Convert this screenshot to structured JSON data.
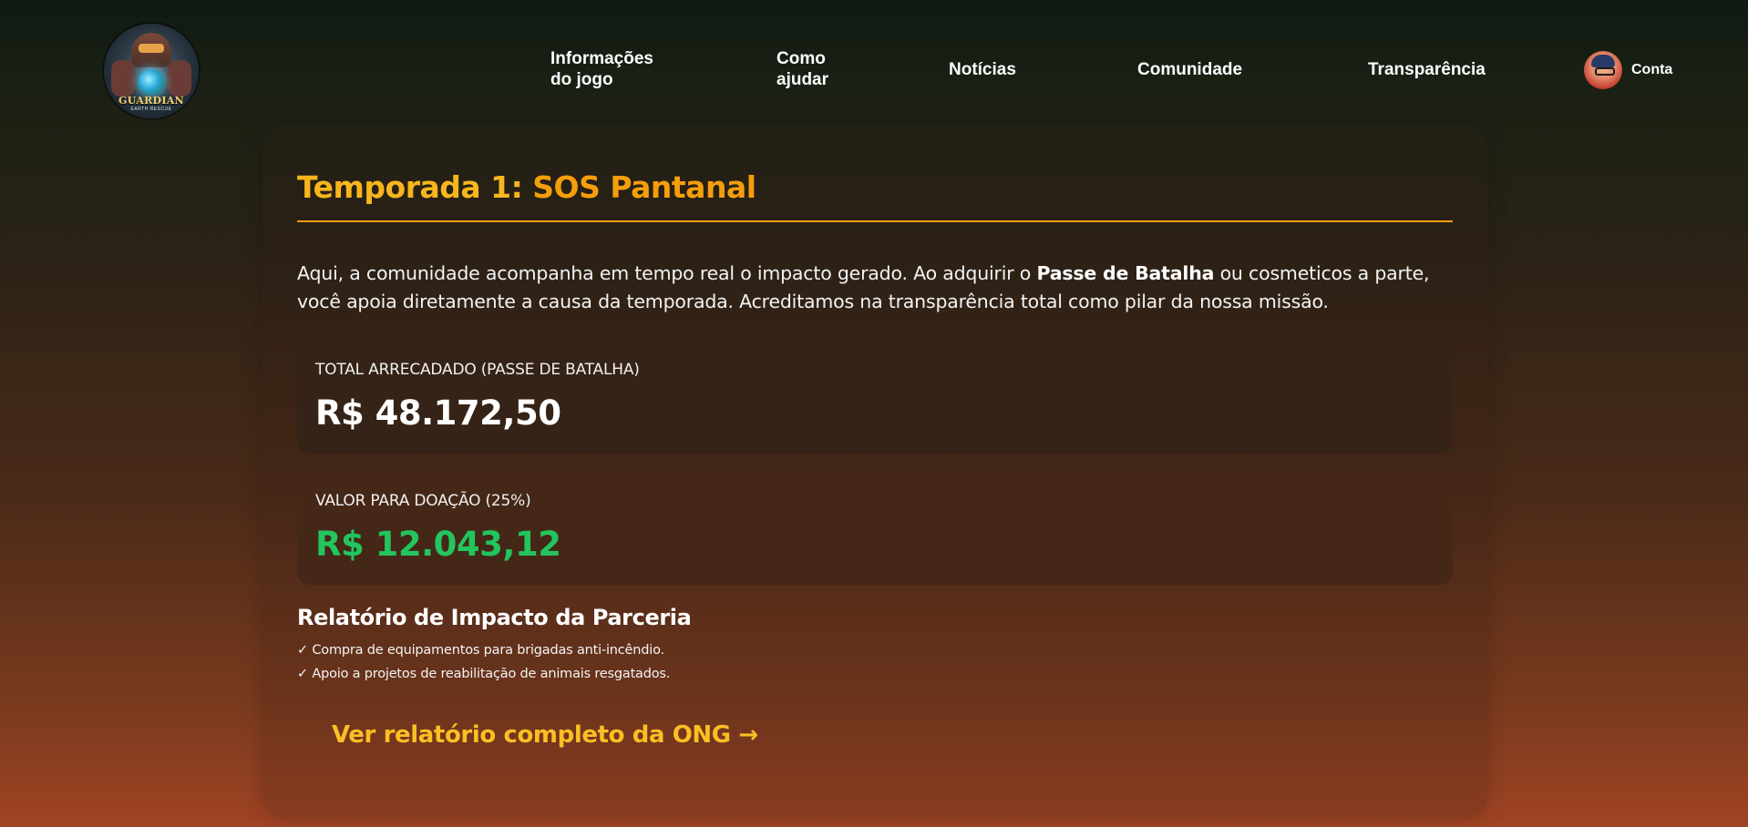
{
  "brand": {
    "logo_text": "GUARDIAN",
    "logo_subtext": "EARTH RESCUE"
  },
  "nav": {
    "items": [
      {
        "label": "Informações\ndo jogo"
      },
      {
        "label": "Como\najudar"
      },
      {
        "label": "Notícias"
      },
      {
        "label": "Comunidade"
      },
      {
        "label": "Transparência"
      }
    ],
    "account_label": "Conta"
  },
  "season": {
    "title_prefix": "Temporada 1: ",
    "title_name": "SOS Pantanal",
    "intro_part1": "Aqui, a comunidade acompanha em tempo real o impacto gerado. Ao adquirir o ",
    "intro_bold": "Passe de Batalha",
    "intro_part2": " ou cosmeticos a parte, você apoia diretamente a causa da temporada. Acreditamos na transparência total como pilar da nossa missão."
  },
  "stats": {
    "total_label": "TOTAL ARRECADADO (PASSE DE BATALHA)",
    "total_value": "R$ 48.172,50",
    "donation_label": "VALOR PARA DOAÇÃO (25%)",
    "donation_value": "R$ 12.043,12"
  },
  "report": {
    "title": "Relatório de Impacto da Parceria",
    "items": [
      "✓ Compra de equipamentos para brigadas anti-incêndio.",
      "✓ Apoio a projetos de reabilitação de animais resgatados."
    ],
    "link_label": "Ver relatório completo da ONG →"
  },
  "colors": {
    "accent": "#f59e0b",
    "link": "#fbbf24",
    "donation": "#22c55e"
  }
}
